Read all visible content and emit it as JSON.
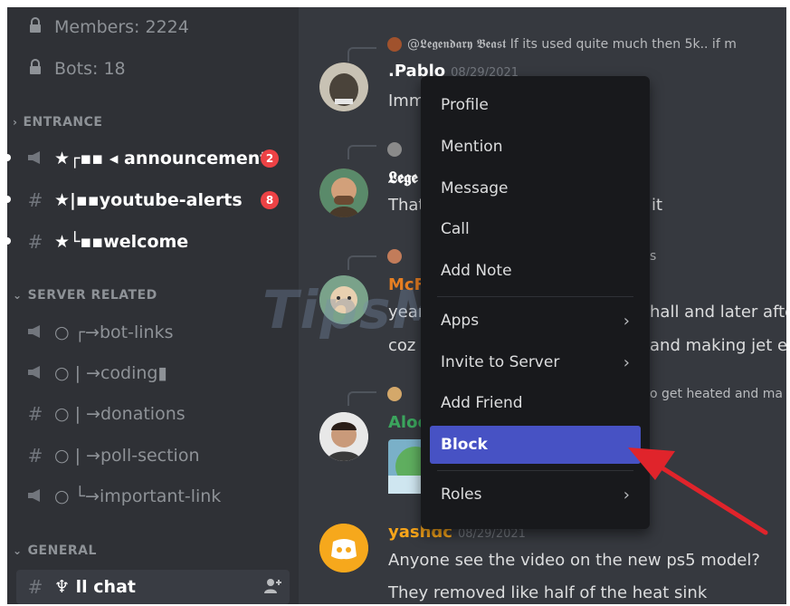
{
  "sidebar": {
    "members": "Members: 2224",
    "bots": "Bots: 18",
    "categories": [
      "ENTRANCE",
      "SERVER RELATED",
      "GENERAL"
    ],
    "entrance": [
      {
        "label": "★┌▪▪ ◂ announcement",
        "badge": "2",
        "icon": "megaphone-icon"
      },
      {
        "label": "★|▪▪youtube-alerts",
        "badge": "8",
        "icon": "hash-icon"
      },
      {
        "label": "★└▪▪welcome",
        "icon": "hash-icon"
      }
    ],
    "server_related": [
      {
        "label": "○ ┌→bot-links",
        "icon": "megaphone-icon"
      },
      {
        "label": "○ | →coding▮",
        "icon": "megaphone-icon"
      },
      {
        "label": "○ | →donations",
        "icon": "hash-icon"
      },
      {
        "label": "○ | →poll-section",
        "icon": "hash-icon"
      },
      {
        "label": "○ └→important-link",
        "icon": "megaphone-icon"
      }
    ],
    "general": [
      {
        "label": "♆ ll chat",
        "icon": "hash-icon"
      }
    ]
  },
  "messages": {
    "reply1": "@𝕷𝖊𝖌𝖊𝖓𝖉𝖆𝖗𝖞 𝕭𝖊𝖆𝖘𝖙 If its used quite much then 5k.. if m",
    "m1_name": ".Pablo",
    "m1_date": "08/29/2021",
    "m1_text": "Imm",
    "m2_name": "𝕷𝖊𝖌𝖊",
    "m2_text_a": "That",
    "m2_text_b": "it",
    "reply3_tail": "s",
    "m3_name": "McF",
    "m3_line1_a": "year",
    "m3_line1_b": "hall and later after",
    "m3_line2_a": "coz p",
    "m3_line2_b": "and making jet eng",
    "reply4_tail": "o get heated and ma",
    "m4_name": "Aloc",
    "m5_name": "yashdc",
    "m5_date": "08/29/2021",
    "m5_line1": "Anyone see the video on the new ps5 model?",
    "m5_line2": "They removed like half of the heat sink"
  },
  "context_menu": {
    "items": [
      "Profile",
      "Mention",
      "Message",
      "Call",
      "Add Note",
      "Apps",
      "Invite to Server",
      "Add Friend",
      "Block",
      "Roles"
    ],
    "active": "Block"
  },
  "watermark": "TipsMake",
  "colors": {
    "accent": "#4752c4",
    "arrow": "#e0242b",
    "badge": "#ed4245",
    "green_name": "#3ba55d",
    "orange_name": "#faa61a"
  }
}
